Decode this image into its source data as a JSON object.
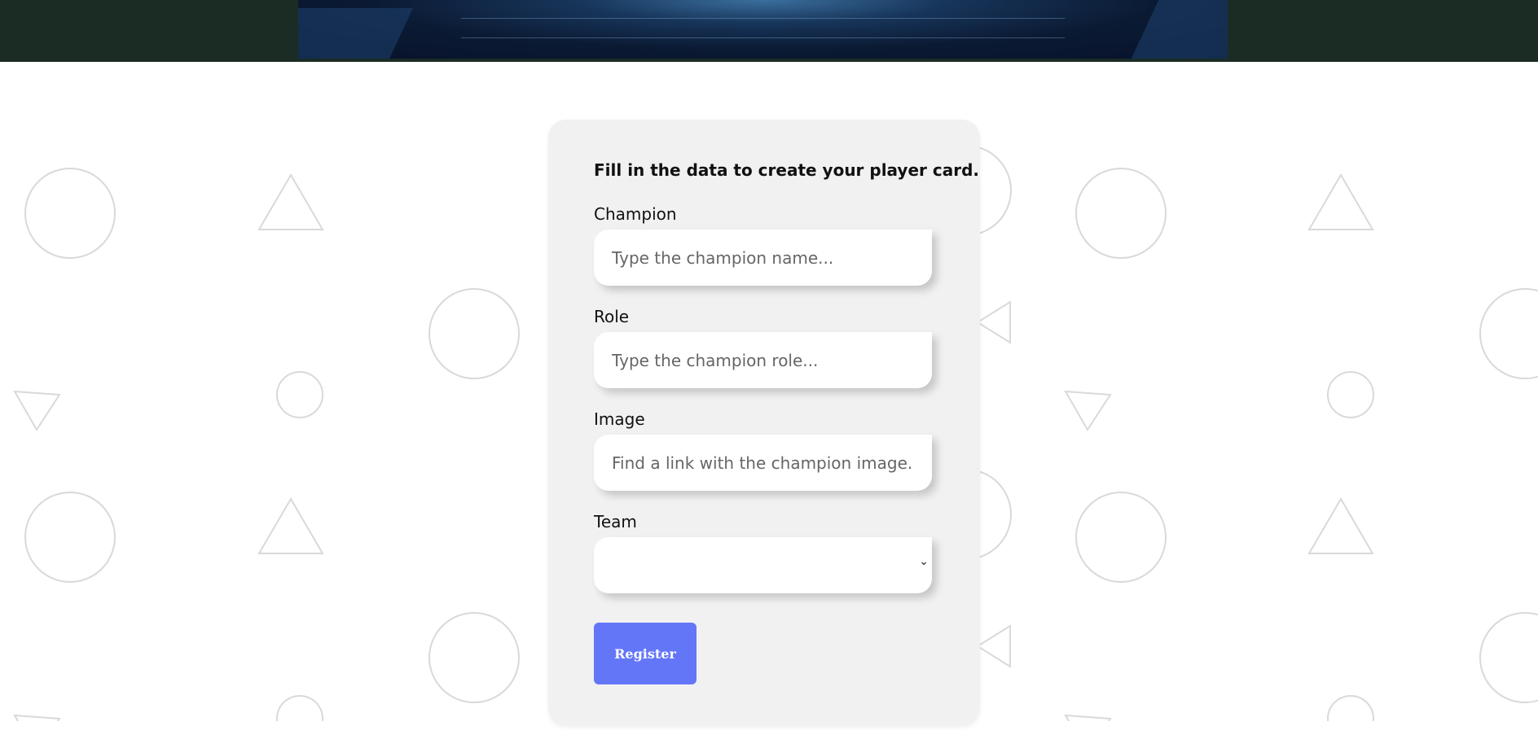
{
  "form": {
    "title": "Fill in the data to create your player card.",
    "fields": [
      {
        "label": "Champion",
        "placeholder": "Type the champion name..."
      },
      {
        "label": "Role",
        "placeholder": "Type the champion role..."
      },
      {
        "label": "Image",
        "placeholder": "Find a link with the champion image..."
      }
    ],
    "team": {
      "label": "Team",
      "value": ""
    },
    "register_label": "Register"
  },
  "colors": {
    "header_bg": "#1b2c25",
    "card_bg": "#f1f1f1",
    "button_bg": "#6476f8",
    "shape_stroke": "#d9d9d9"
  }
}
